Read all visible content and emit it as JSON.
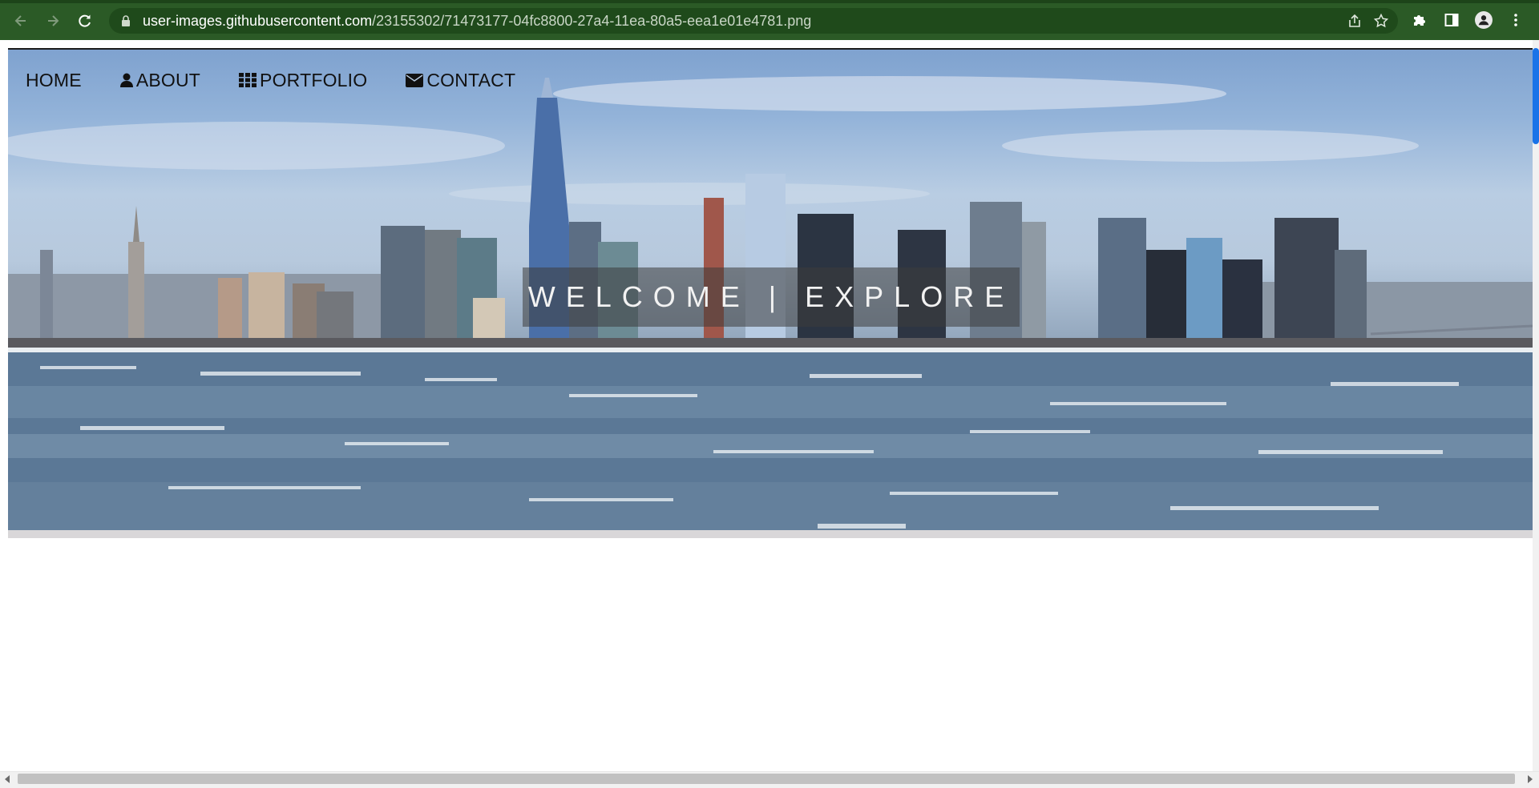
{
  "browser": {
    "url_host": "user-images.githubusercontent.com",
    "url_path": "/23155302/71473177-04fc8800-27a4-11ea-80a5-eea1e01e4781.png",
    "chrome_color": "#2b5a26"
  },
  "page": {
    "nav": {
      "home": "HOME",
      "about": "ABOUT",
      "portfolio": "PORTFOLIO",
      "contact": "CONTACT"
    },
    "hero_title": "WELCOME | EXPLORE"
  }
}
